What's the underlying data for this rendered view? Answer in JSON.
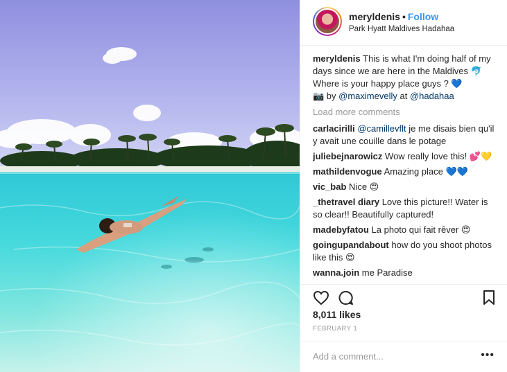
{
  "header": {
    "username": "meryldenis",
    "separator": "•",
    "follow_label": "Follow",
    "location": "Park Hyatt Maldives Hadahaa"
  },
  "caption": {
    "username": "meryldenis",
    "line1": "This is what I'm doing half of my days since we are here in the Maldives 🐬",
    "line2": "Where is your happy place guys ? 💙",
    "line3_prefix": "📷 by ",
    "mention1": "@maximevelly",
    "at_text": " at ",
    "mention2": "@hadahaa"
  },
  "load_more": "Load more comments",
  "comments": [
    {
      "user": "carlacirilli",
      "mention": "@camillevflt",
      "text": " je me disais bien qu'il y avait une couille dans le potage"
    },
    {
      "user": "juliebejnarowicz",
      "mention": "",
      "text": "Wow really love this! 💕💛"
    },
    {
      "user": "mathildenvogue",
      "mention": "",
      "text": "Amazing place 💙💙"
    },
    {
      "user": "vic_bab",
      "mention": "",
      "text": "Nice 😍"
    },
    {
      "user": "_thetravel diary",
      "mention": "",
      "text": "Love this picture!! Water is so clear!! Beautifully captured!"
    },
    {
      "user": "madebyfatou",
      "mention": "",
      "text": "La photo qui fait rêver 😍"
    },
    {
      "user": "goingupandabout",
      "mention": "",
      "text": "how do you shoot photos like this 😍"
    },
    {
      "user": "wanna.join",
      "mention": "",
      "text": "me Paradise"
    }
  ],
  "likes": "8,011 likes",
  "date": "FEBRUARY 1",
  "add_comment_placeholder": "Add a comment...",
  "more_label": "•••",
  "icons": {
    "like": "heart-icon",
    "comment": "comment-icon",
    "save": "bookmark-icon",
    "more": "more-options-icon"
  },
  "colors": {
    "link": "#3897f0",
    "mention": "#003569",
    "muted": "#999999",
    "text": "#262626"
  }
}
